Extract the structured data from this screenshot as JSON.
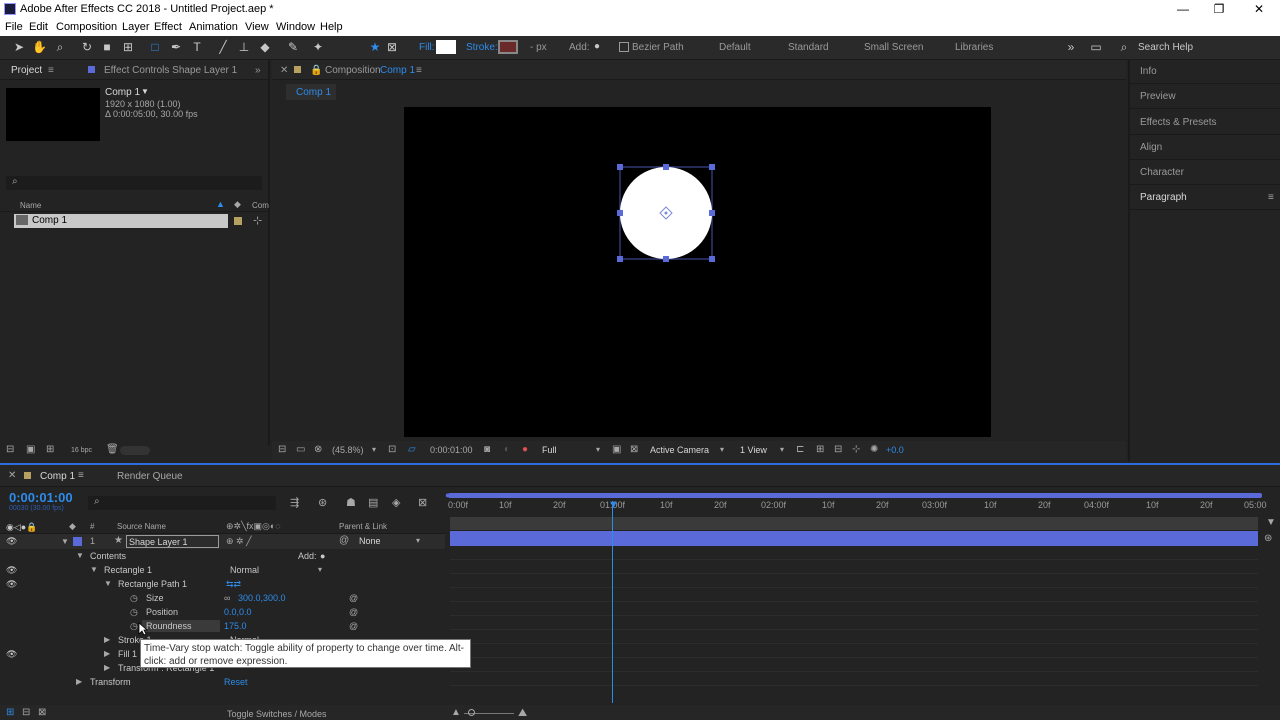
{
  "window": {
    "title": "Adobe After Effects CC 2018 - Untitled Project.aep *",
    "controls": [
      "—",
      "❐",
      "✕"
    ]
  },
  "menu": [
    "File",
    "Edit",
    "Composition",
    "Layer",
    "Effect",
    "Animation",
    "View",
    "Window",
    "Help"
  ],
  "toolbar": {
    "fill_label": "Fill:",
    "stroke_label": "Stroke:",
    "stroke_width": "- px",
    "add_label": "Add:",
    "bezier_label": "Bezier Path",
    "workspaces": [
      "Default",
      "Standard",
      "Small Screen",
      "Libraries"
    ],
    "search_placeholder": "Search Help"
  },
  "project": {
    "tab_project": "Project",
    "tab_effect": "Effect Controls Shape Layer 1",
    "comp_name": "Comp 1",
    "comp_dims": "1920 x 1080 (1.00)",
    "comp_dur": "Δ 0:00:05:00, 30.00 fps",
    "col_name": "Name",
    "col_comment": "Com",
    "item": "Comp 1",
    "bpc": "16 bpc"
  },
  "composition": {
    "tab_label": "Composition",
    "tab_comp": "Comp 1",
    "subtab": "Comp 1",
    "zoom": "(45.8%)",
    "time": "0:00:01:00",
    "resolution": "Full",
    "camera": "Active Camera",
    "views": "1 View",
    "exposure": "+0.0"
  },
  "right_panels": [
    "Info",
    "Preview",
    "Effects & Presets",
    "Align",
    "Character",
    "Paragraph"
  ],
  "timeline": {
    "tab_comp": "Comp 1",
    "tab_render": "Render Queue",
    "current_time": "0:00:01:00",
    "current_frames": "00030 (30.00 fps)",
    "col_source": "Source Name",
    "col_parent": "Parent & Link",
    "layer_num": "1",
    "layer_name": "Shape Layer 1",
    "parent_value": "None",
    "contents": "Contents",
    "add_label": "Add:",
    "rectangle": "Rectangle 1",
    "blend_mode": "Normal",
    "rect_path": "Rectangle Path 1",
    "size_label": "Size",
    "size_value": "300.0,300.0",
    "position_label": "Position",
    "position_value": "0.0,0.0",
    "roundness_label": "Roundness",
    "roundness_value": "175.0",
    "stroke_label": "Stroke 1",
    "stroke_mode": "Normal",
    "fill_label": "Fill 1",
    "transform_rect": "Transform : Rectangle 1",
    "transform_label": "Transform",
    "reset_label": "Reset",
    "toggle_label": "Toggle Switches / Modes",
    "ruler": [
      "0:00f",
      "10f",
      "20f",
      "01:00f",
      "10f",
      "20f",
      "02:00f",
      "10f",
      "20f",
      "03:00f",
      "10f",
      "20f",
      "04:00f",
      "10f",
      "20f",
      "05:00"
    ],
    "tooltip": "Time-Vary stop watch: Toggle ability of property to change over time. Alt-click: add or remove expression."
  }
}
